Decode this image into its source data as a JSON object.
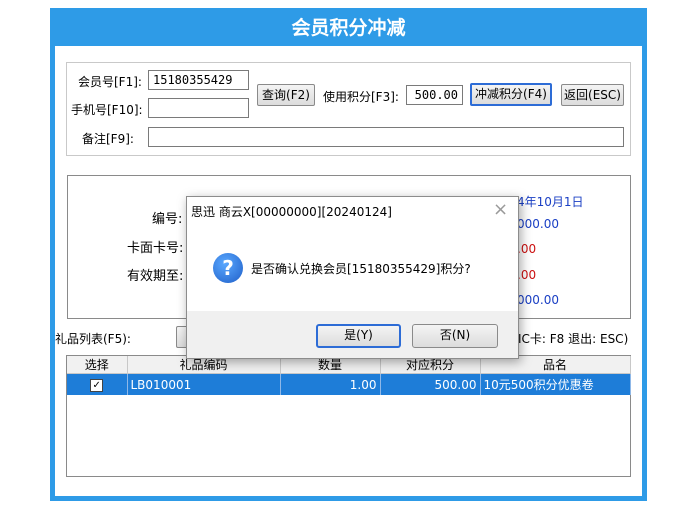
{
  "window": {
    "title": "会员积分冲减"
  },
  "form": {
    "member_label": "会员号[F1]:",
    "member_value": "15180355429",
    "phone_label": "手机号[F10]:",
    "phone_value": "",
    "query_button": "查询(F2)",
    "use_points_label": "使用积分[F3]:",
    "use_points_value": "500.00",
    "deduct_button": "冲减积分(F4)",
    "back_button": "返回(ESC)",
    "note_label": "备注[F9]:",
    "note_value": ""
  },
  "info": {
    "number_label": "编号:",
    "card_label": "卡面卡号:",
    "expiry_label": "有效期至:",
    "partial_top": "4年10月1日",
    "partial_value_1": "000.00",
    "partial_value_2": ".00",
    "partial_value_3": ".00",
    "partial_value_4": "000.00"
  },
  "gift": {
    "list_label": "礼品列表(F5):",
    "shortcut_hint": "IC卡: F8 退出: ESC)"
  },
  "table": {
    "headers": [
      "选择",
      "礼品编码",
      "数量",
      "对应积分",
      "品名"
    ],
    "rows": [
      {
        "checked": "✓",
        "code": "LB010001",
        "qty": "1.00",
        "points": "500.00",
        "name": "10元500积分优惠卷"
      }
    ]
  },
  "dialog": {
    "title": "思迅 商云X[00000000][20240124]",
    "message": "是否确认兑换会员[15180355429]积分?",
    "yes_button": "是(Y)",
    "no_button": "否(N)",
    "close_symbol": "×",
    "icon_symbol": "?"
  }
}
